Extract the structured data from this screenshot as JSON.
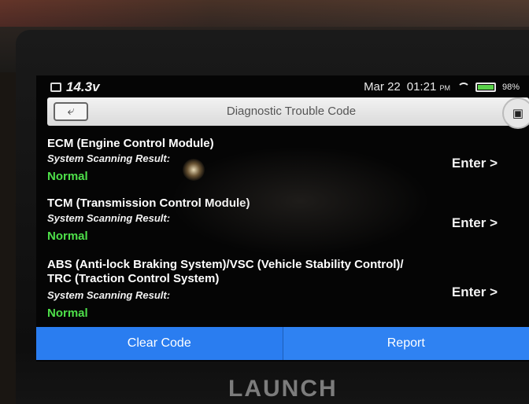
{
  "status_bar": {
    "voltage": "14.3v",
    "date": "Mar 22",
    "time": "01:21",
    "ampm": "PM",
    "battery": "98%"
  },
  "header": {
    "title": "Diagnostic Trouble Code",
    "back_icon": "back-arrow-icon",
    "screenshot_icon": "camera-icon"
  },
  "modules": [
    {
      "name": "ECM (Engine Control Module)",
      "result_label": "System Scanning Result:",
      "status": "Normal",
      "action": "Enter >"
    },
    {
      "name": "TCM (Transmission Control Module)",
      "result_label": "System Scanning Result:",
      "status": "Normal",
      "action": "Enter >"
    },
    {
      "name": "ABS (Anti-lock Braking System)/VSC (Vehicle Stability Control)/ TRC (Traction Control System)",
      "result_label": "System Scanning Result:",
      "status": "Normal",
      "action": "Enter >"
    }
  ],
  "footer": {
    "clear_label": "Clear Code",
    "report_label": "Report"
  },
  "device": {
    "brand": "LAUNCH"
  },
  "colors": {
    "status_normal": "#4ee04a",
    "button_blue": "#2a7df0"
  }
}
